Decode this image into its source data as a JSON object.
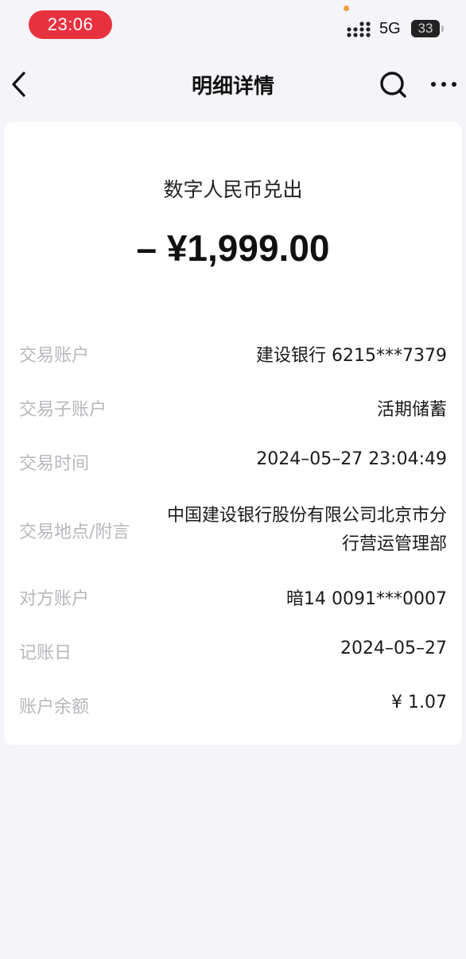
{
  "status_bar": {
    "time": "23:06",
    "network": "5G",
    "battery": "33"
  },
  "nav": {
    "title": "明细详情"
  },
  "transaction": {
    "type": "数字人民币兑出",
    "amount": "– ¥1,999.00"
  },
  "details": [
    {
      "label": "交易账户",
      "value": "建设银行 6215***7379"
    },
    {
      "label": "交易子账户",
      "value": "活期储蓄"
    },
    {
      "label": "交易时间",
      "value": "2024–05–27 23:04:49"
    },
    {
      "label": "交易地点/附言",
      "value": "中国建设银行股份有限公司北京市分行营运管理部"
    },
    {
      "label": "对方账户",
      "value": "暗14 0091***0007"
    },
    {
      "label": "记账日",
      "value": "2024–05–27"
    },
    {
      "label": "账户余额",
      "value": "¥ 1.07"
    }
  ]
}
